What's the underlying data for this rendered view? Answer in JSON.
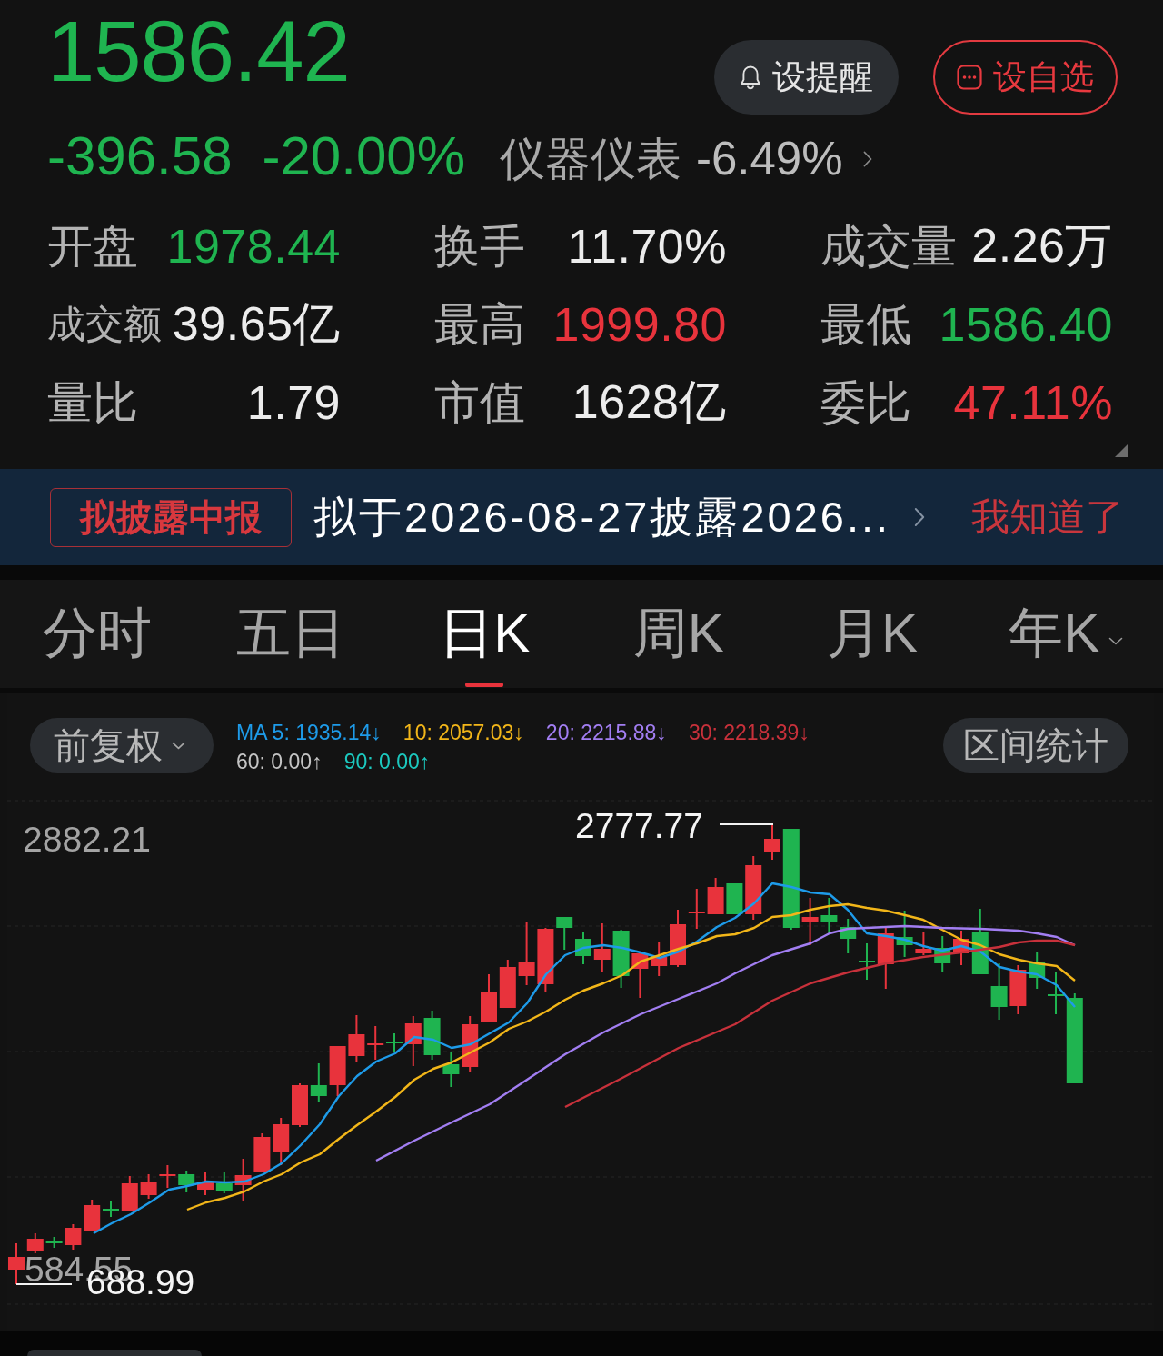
{
  "quote": {
    "price": "1586.42",
    "falling": true,
    "change": "-396.58",
    "change_percent": "-20.00%",
    "sector": {
      "name": "仪器仪表",
      "change": "-6.49%"
    }
  },
  "actions": [
    {
      "kind": "alert",
      "label": "设提醒"
    },
    {
      "kind": "watchlist",
      "label": "设自选"
    }
  ],
  "stats": [
    {
      "label": "开盘",
      "value": "1978.44",
      "color": "#1fb450",
      "compact": false
    },
    {
      "label": "换手",
      "value": "11.70%",
      "color": "#ececec",
      "compact": false
    },
    {
      "label": "成交量",
      "value": "2.26万",
      "color": "#ececec",
      "compact": false
    },
    {
      "label": "成交额",
      "value": "39.65亿",
      "color": "#ececec",
      "compact": true
    },
    {
      "label": "最高",
      "value": "1999.80",
      "color": "#e8333c",
      "compact": false
    },
    {
      "label": "最低",
      "value": "1586.40",
      "color": "#1fb450",
      "compact": false
    },
    {
      "label": "量比",
      "value": "1.79",
      "color": "#ececec",
      "compact": false
    },
    {
      "label": "市值",
      "value": "1628亿",
      "color": "#ececec",
      "compact": false
    },
    {
      "label": "委比",
      "value": "47.11%",
      "color": "#e8333c",
      "compact": false
    }
  ],
  "notice": {
    "tag": "拟披露中报",
    "text": "拟于2026-08-27披露2026...",
    "dismiss": "我知道了"
  },
  "tabs": [
    {
      "label": "分时",
      "selected": false,
      "dropdown": false
    },
    {
      "label": "五日",
      "selected": false,
      "dropdown": false
    },
    {
      "label": "日K",
      "selected": true,
      "dropdown": false
    },
    {
      "label": "周K",
      "selected": false,
      "dropdown": false
    },
    {
      "label": "月K",
      "selected": false,
      "dropdown": false
    },
    {
      "label": "年K",
      "selected": false,
      "dropdown": true
    }
  ],
  "chart": {
    "adjust": "前复权",
    "range_stats": "区间统计",
    "ma_legend": [
      [
        {
          "text": "MA 5: 1935.14↓",
          "color": "#1e9be9"
        },
        {
          "text": "10: 2057.03↓",
          "color": "#f2b619"
        },
        {
          "text": "20: 2215.88↓",
          "color": "#a27ef2"
        },
        {
          "text": "30: 2218.39↓",
          "color": "#c8313b"
        }
      ],
      [
        {
          "text": "60: 0.00↑",
          "color": "#c4c4c4"
        },
        {
          "text": "90: 0.00↑",
          "color": "#1cc9bf"
        }
      ]
    ],
    "axis_labels": [
      {
        "kind": "top",
        "text": "2882.21"
      },
      {
        "kind": "bottom",
        "text": "584.55"
      }
    ],
    "markers": [
      {
        "kind": "high",
        "text": "2777.77"
      },
      {
        "kind": "low",
        "text": "688.99"
      }
    ]
  }
}
